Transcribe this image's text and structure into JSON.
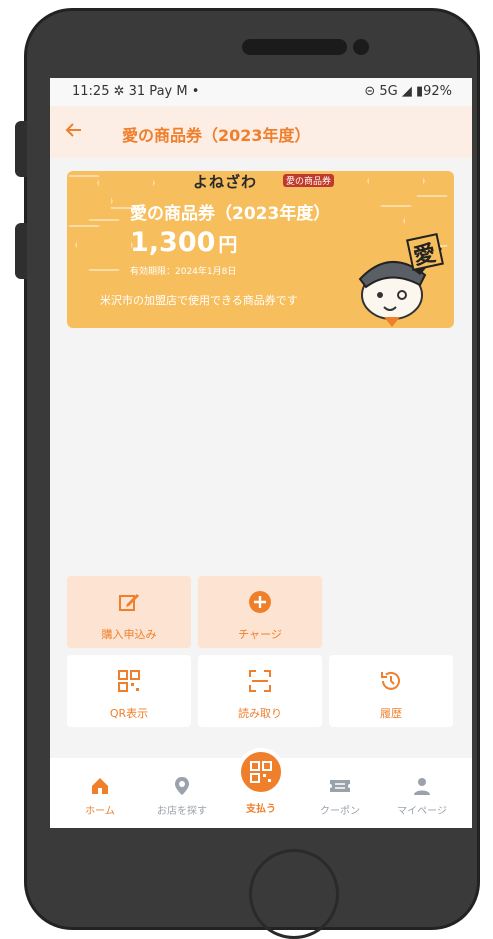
{
  "status_bar": {
    "time": "11:25",
    "icons_left": "✲ 31 Pay M •",
    "icons_right": "⊝ 5G ◢ ▮92%"
  },
  "app_bar": {
    "back_icon": "arrow-left-icon",
    "title": "愛の商品券（2023年度）"
  },
  "card": {
    "brand": "よねざわ",
    "brand_sub": "愛の商品券",
    "title": "愛の商品券（2023年度）",
    "amount": "1,300",
    "currency": "円",
    "expiry": "有効期限：2024年1月8日",
    "description": "米沢市の加盟店で使用できる商品券です",
    "mascot_char": "愛"
  },
  "actions": [
    {
      "label": "購入申込み",
      "icon": "edit-icon"
    },
    {
      "label": "チャージ",
      "icon": "plus-circle-icon"
    },
    {
      "label": "QR表示",
      "icon": "qr-code-icon"
    },
    {
      "label": "読み取り",
      "icon": "scan-icon"
    },
    {
      "label": "履歴",
      "icon": "history-icon"
    }
  ],
  "nav": [
    {
      "label": "ホーム",
      "icon": "home-icon"
    },
    {
      "label": "お店を探す",
      "icon": "location-pin-icon"
    },
    {
      "label": "支払う",
      "icon": "qr-pay-icon"
    },
    {
      "label": "クーポン",
      "icon": "coupon-icon"
    },
    {
      "label": "マイページ",
      "icon": "user-icon"
    }
  ],
  "colors": {
    "accent": "#ef7f2b",
    "card": "#f7be5d",
    "tile_peach": "#fde4d2"
  }
}
